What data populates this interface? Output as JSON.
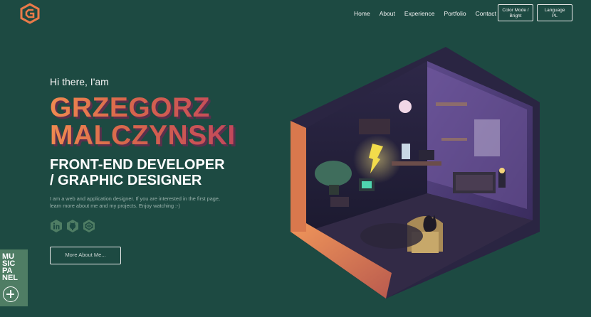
{
  "header": {
    "logo_icon": "hexagon-g-logo",
    "nav": [
      "Home",
      "About",
      "Experience",
      "Portfolio",
      "Contact"
    ],
    "color_mode_label": "Color Mode /",
    "color_mode_value": "Bright",
    "language_label": "Language",
    "language_value": "PL"
  },
  "hero": {
    "greeting": "Hi there, I'am",
    "name_line1": "GRZEGORZ",
    "name_line2": "MALCZYNSKI",
    "role_line1": "FRONT-END DEVELOPER",
    "role_line2": "/ GRAPHIC DESIGNER",
    "description": "I am a web and application designer. If you are interested in the first page, learn more about me and my projects. Enjoy watching :-)",
    "socials": [
      "linkedin-icon",
      "github-icon",
      "codepen-icon"
    ],
    "cta": "More About Me..."
  },
  "music_panel": {
    "lines": [
      "MU",
      "SIC",
      "PA",
      "NEL"
    ],
    "icon": "plus-icon"
  },
  "colors": {
    "background": "#1d4a42",
    "accent_orange": "#f08a50",
    "accent_pink": "#c2485b",
    "panel_green": "#4f7d64"
  }
}
